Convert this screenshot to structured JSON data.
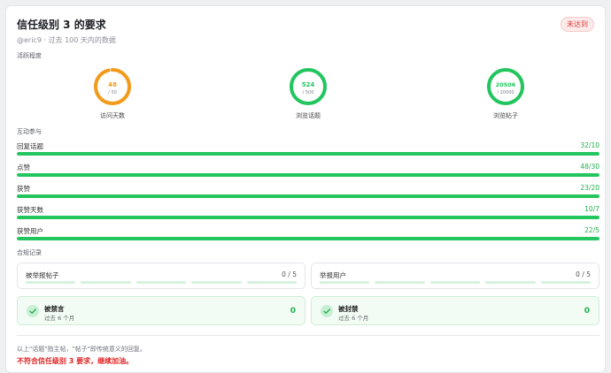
{
  "header": {
    "title": "信任级别 3 的要求",
    "badge": "未达到",
    "subtitle": "@eric9 · 过去 100 天内的数据"
  },
  "activity": {
    "section_label": "活跃程度",
    "rings": [
      {
        "value": "48",
        "max": "/ 50",
        "label": "访问天数",
        "fraction": 0.96,
        "color": "#f29a1b"
      },
      {
        "value": "524",
        "max": "/ 500",
        "label": "浏览话题",
        "fraction": 1.0,
        "color": "#22c55e"
      },
      {
        "value": "20506",
        "max": "/ 20000",
        "label": "浏览帖子",
        "fraction": 1.0,
        "color": "#22c55e"
      }
    ]
  },
  "engagement": {
    "section_label": "互动参与",
    "bars": [
      {
        "label": "回复话题",
        "value": "32/10",
        "fraction": 1.0
      },
      {
        "label": "点赞",
        "value": "48/30",
        "fraction": 1.0
      },
      {
        "label": "获赞",
        "value": "23/20",
        "fraction": 1.0
      },
      {
        "label": "获赞天数",
        "value": "10/7",
        "fraction": 1.0
      },
      {
        "label": "获赞用户",
        "value": "22/5",
        "fraction": 1.0
      }
    ]
  },
  "compliance": {
    "section_label": "合规记录",
    "reported_posts": {
      "label": "被举报帖子",
      "value": "0 / 5"
    },
    "reporting_users": {
      "label": "举报用户",
      "value": "0 / 5"
    },
    "silenced": {
      "title": "被禁言",
      "sub": "过去 6 个月",
      "value": "0"
    },
    "suspended": {
      "title": "被封禁",
      "sub": "过去 6 个月",
      "value": "0"
    }
  },
  "footer": {
    "note": "以上\"话题\"指主帖，\"帖子\"即传统意义的回复。",
    "warning": "不符合信任级别 3 要求，继续加油。"
  },
  "colors": {
    "accent_green": "#22c55e",
    "accent_orange": "#f29a1b",
    "warning_red": "#e02424"
  }
}
